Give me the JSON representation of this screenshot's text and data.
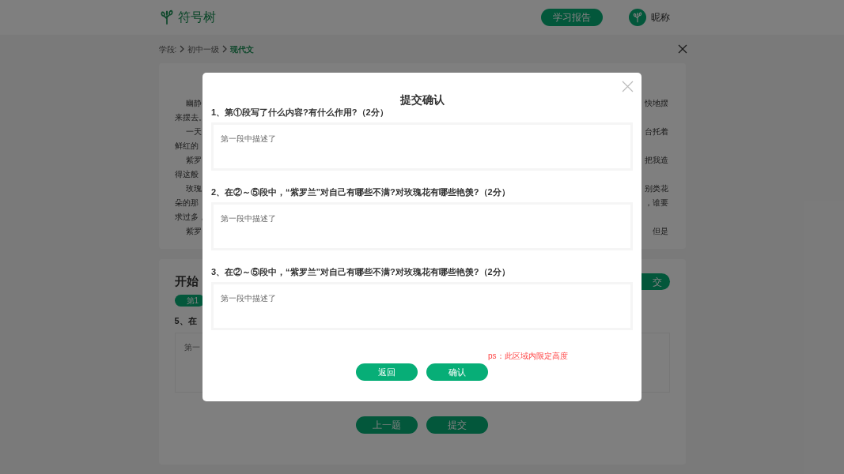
{
  "header": {
    "logo_text": "符号树",
    "report_button": "学习报告",
    "user_name": "昵称"
  },
  "breadcrumb": {
    "label": "学段:",
    "items": [
      {
        "text": "初中一级",
        "selected": false
      },
      {
        "text": "现代文",
        "selected": true
      }
    ]
  },
  "passage": [
    {
      "indent": true,
      "left": "幽静",
      "right": "快地摆"
    },
    {
      "indent": false,
      "left": "来摆去。"
    },
    {
      "indent": true,
      "left": "一天",
      "right": "台托着"
    },
    {
      "indent": false,
      "left": "鲜红的"
    },
    {
      "indent": true,
      "left": "紫罗",
      "right": "把我造"
    },
    {
      "indent": false,
      "left": "得这般"
    },
    {
      "indent": true,
      "left": "玫瑰",
      "right": "别类花"
    },
    {
      "indent": false,
      "left": "朵的那",
      "right": "，谁要"
    },
    {
      "indent": false,
      "left": "求过多，"
    },
    {
      "indent": true,
      "left": "紫罗",
      "right": "但是"
    }
  ],
  "answer_card": {
    "title": "开始",
    "submit_button": "交",
    "question_tab": "第1",
    "question": "5、在",
    "answer": "第一",
    "nav_buttons": [
      "上一题",
      "提交"
    ]
  },
  "modal": {
    "title": "提交确认",
    "questions": [
      {
        "text": "1、第①段写了什么内容?有什么作用?（2分）",
        "answer": "第一段中描述了"
      },
      {
        "text": "2、在②～⑤段中，“紫罗兰”对自己有哪些不满?对玫瑰花有哪些艳羡?（2分）",
        "answer": "第一段中描述了"
      },
      {
        "text": "3、在②～⑤段中，“紫罗兰”对自己有哪些不满?对玫瑰花有哪些艳羡?（2分）",
        "answer": "第一段中描述了"
      }
    ],
    "note": "ps：此区域内限定高度",
    "buttons": [
      "返回",
      "确认"
    ]
  }
}
